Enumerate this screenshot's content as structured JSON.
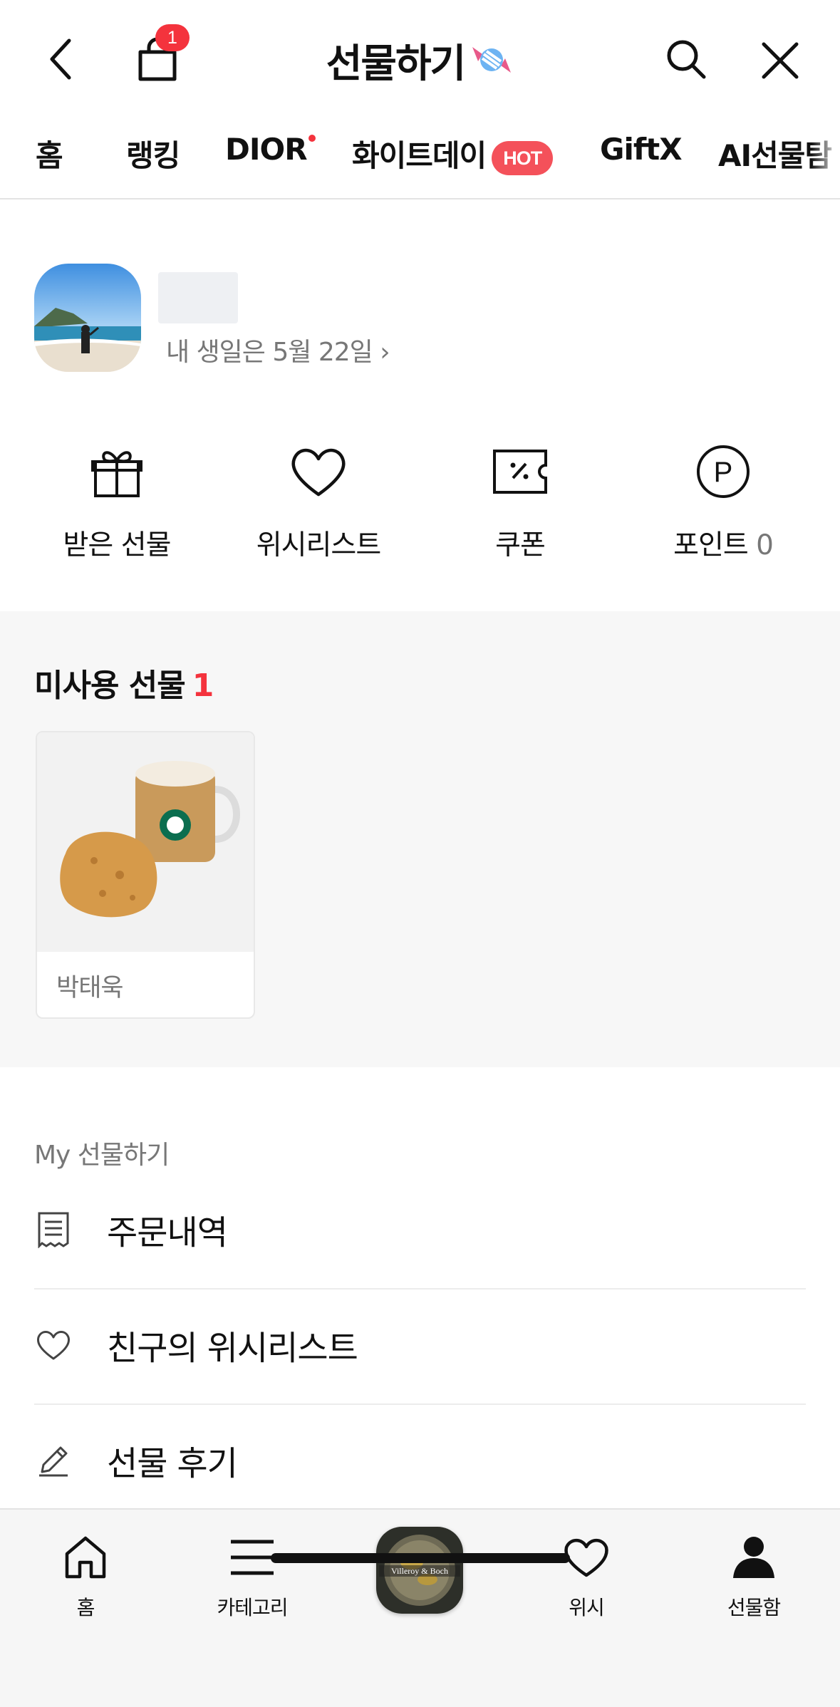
{
  "header": {
    "title": "선물하기",
    "bag_count": "1"
  },
  "tabs": [
    {
      "label": "홈"
    },
    {
      "label": "랭킹"
    },
    {
      "label": "DIOR"
    },
    {
      "label": "화이트데이",
      "badge": "HOT"
    },
    {
      "label": "GiftX"
    },
    {
      "label": "AI선물탐"
    }
  ],
  "profile": {
    "birthday_text": "내 생일은 5월 22일 ›"
  },
  "quick_menu": [
    {
      "label": "받은 선물",
      "icon": "gift-icon"
    },
    {
      "label": "위시리스트",
      "icon": "heart-icon"
    },
    {
      "label": "쿠폰",
      "icon": "coupon-icon"
    },
    {
      "label": "포인트",
      "value": "0",
      "icon": "point-icon"
    }
  ],
  "unused_gifts": {
    "title": "미사용 선물",
    "count": "1",
    "items": [
      {
        "sender": "박태욱",
        "image": "coffee-and-scone"
      }
    ]
  },
  "my_menu": {
    "label": "My 선물하기",
    "items": [
      {
        "label": "주문내역",
        "icon": "receipt-icon"
      },
      {
        "label": "친구의 위시리스트",
        "icon": "heart-outline-icon"
      },
      {
        "label": "선물 후기",
        "icon": "pencil-icon"
      }
    ]
  },
  "bottom_nav": [
    {
      "label": "홈",
      "icon": "home-icon"
    },
    {
      "label": "카테고리",
      "icon": "menu-icon"
    },
    {
      "label": "",
      "icon": "promo-banner"
    },
    {
      "label": "위시",
      "icon": "heart-icon"
    },
    {
      "label": "선물함",
      "icon": "person-icon"
    }
  ],
  "promo": {
    "brand_text": "Villeroy & Boch"
  },
  "colors": {
    "accent_red": "#f4333d",
    "hot_badge": "#f4515a",
    "text_primary": "#111111",
    "text_secondary": "#777777",
    "section_bg": "#f7f7f7"
  }
}
